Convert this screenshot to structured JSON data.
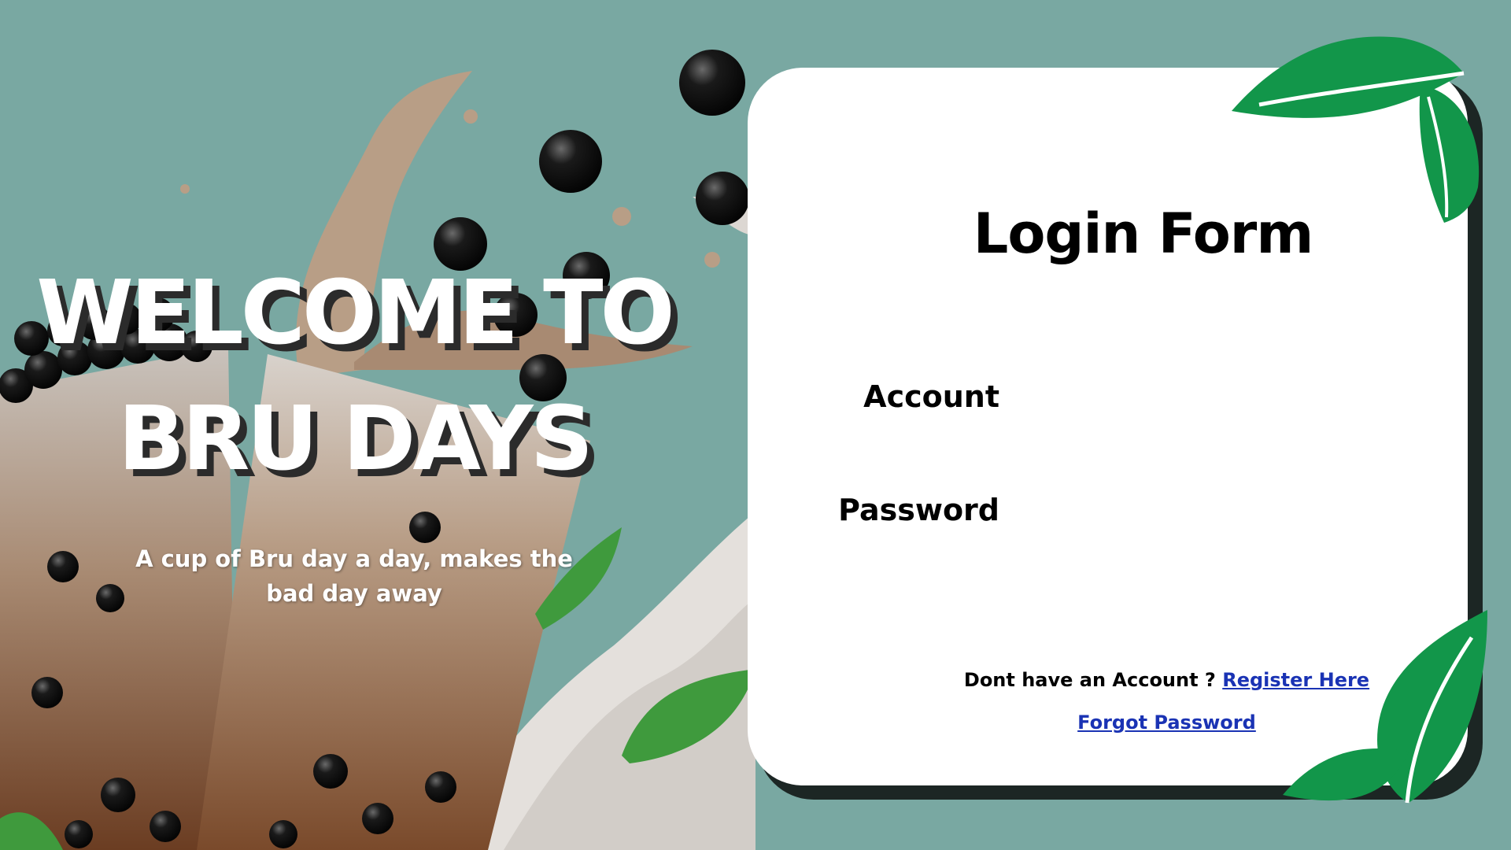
{
  "hero": {
    "headline_line1": "WELCOME TO",
    "headline_line2": "BRU DAYS",
    "tagline": "A cup of Bru day a day, makes the bad day away"
  },
  "login": {
    "title": "Login Form",
    "account_label": "Account",
    "password_label": "Password",
    "account_value": "",
    "password_value": "",
    "register_prompt": "Dont have an Account ?",
    "register_link": "Register Here",
    "forgot_link": "Forgot Password"
  },
  "colors": {
    "background": "#79a8a2",
    "card": "#ffffff",
    "card_shadow": "#1c2624",
    "link": "#1a33b4",
    "leaf": "#12964a"
  },
  "icons": [
    "boba-tea-illustration",
    "leaf-decoration"
  ]
}
